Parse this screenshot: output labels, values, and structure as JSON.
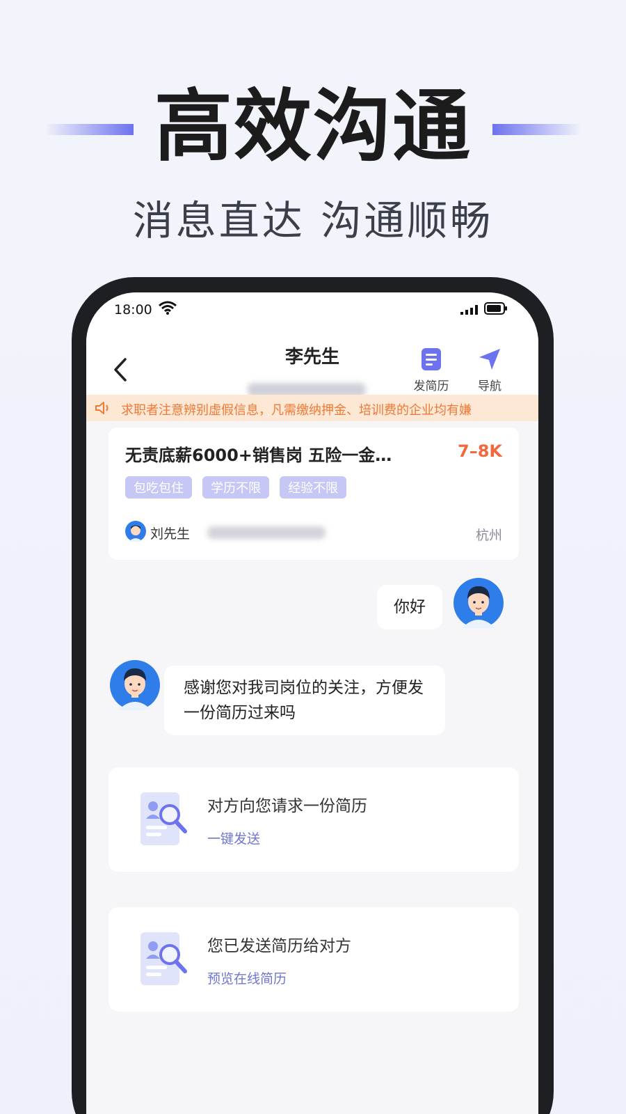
{
  "hero": {
    "title": "高效沟通",
    "subtitle": "消息直达  沟通顺畅"
  },
  "status_bar": {
    "time": "18:00"
  },
  "header": {
    "contact_name": "李先生",
    "actions": [
      {
        "label": "发简历",
        "icon": "document-icon"
      },
      {
        "label": "导航",
        "icon": "navigation-arrow-icon"
      }
    ]
  },
  "notice": {
    "text": "求职者注意辨别虚假信息，凡需缴纳押金、培训费的企业均有嫌"
  },
  "job_card": {
    "title": "无责底薪6000+销售岗 五险一金…",
    "salary": "7–8K",
    "tags": [
      "包吃包住",
      "学历不限",
      "经验不限"
    ],
    "recruiter_name": "刘先生",
    "city": "杭州"
  },
  "messages": [
    {
      "from": "me",
      "text": "你好"
    },
    {
      "from": "them",
      "text": "感谢您对我司岗位的关注，方便发一份简历过来吗"
    }
  ],
  "system_cards": [
    {
      "text": "对方向您请求一份简历",
      "link": "一键发送"
    },
    {
      "text": "您已发送简历给对方",
      "link": "预览在线简历"
    }
  ],
  "colors": {
    "accent": "#6d72ee",
    "salary": "#f06a3e",
    "notice_bg": "#fde7d5",
    "notice_text": "#ee7a35",
    "tag_bg": "#c6c7f5"
  }
}
